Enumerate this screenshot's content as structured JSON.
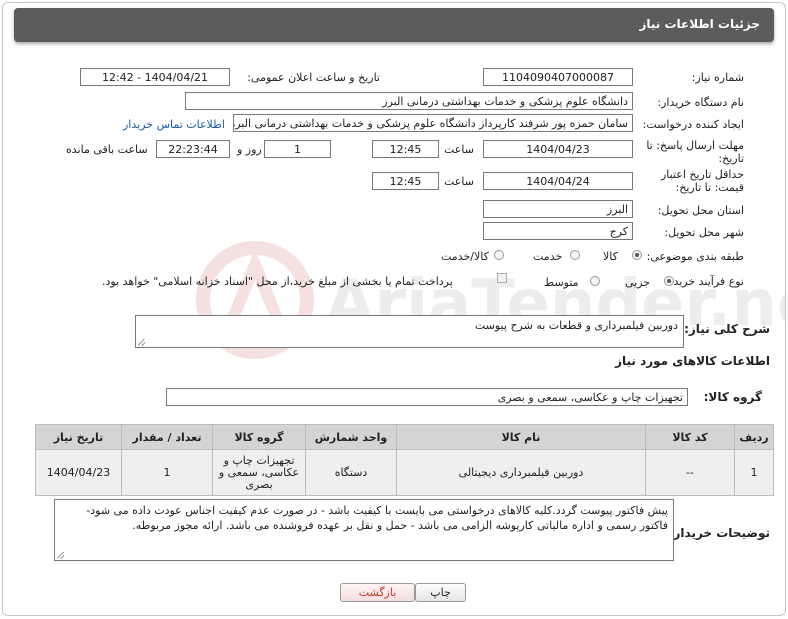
{
  "header": {
    "title": "جزئیات اطلاعات نیاز"
  },
  "fields": {
    "need_number_label": "شماره نیاز:",
    "need_number": "1104090407000087",
    "announce_label": "تاریخ و ساعت اعلان عمومی:",
    "announce_value": "1404/04/21 - 12:42",
    "buyer_label": "نام دستگاه خریدار:",
    "buyer_value": "دانشگاه علوم پزشکی و خدمات بهداشتی  درمانی البرز",
    "creator_label": "ایجاد کننده درخواست:",
    "creator_value": "سامان حمزه پور شرفند کارپرداز دانشگاه علوم پزشکی و خدمات بهداشتی  درمانی البرز",
    "contact_link": "اطلاعات تماس خریدار",
    "deadline_label": "مهلت ارسال پاسخ: تا تاریخ:",
    "deadline_date": "1404/04/23",
    "time_label": "ساعت",
    "deadline_time": "12:45",
    "days_value": "1",
    "days_label": "روز و",
    "remaining_value": "22:23:44",
    "remaining_label": "ساعت باقی مانده",
    "validity_label": "حداقل تاریخ اعتبار قیمت: تا تاریخ:",
    "validity_date": "1404/04/24",
    "validity_time": "12:45",
    "province_label": "استان محل تحویل:",
    "province_value": "البرز",
    "city_label": "شهر محل تحویل:",
    "city_value": "کرج",
    "category_label": "طبقه بندی موضوعی:",
    "category_options": [
      "کالا",
      "خدمت",
      "کالا/خدمت"
    ],
    "process_label": "نوع فرآیند خرید :",
    "process_options": [
      "جزیی",
      "متوسط"
    ],
    "payment_note": "پرداخت تمام یا بخشی از مبلغ خرید،از محل \"اسناد خزانه اسلامی\" خواهد بود."
  },
  "description": {
    "label": "شرح کلی نیاز:",
    "value": "دوربین فیلمبرداری و قطعات به شرح پیوست"
  },
  "goods_info_title": "اطلاعات کالاهای مورد نیاز",
  "goods_group": {
    "label": "گروه کالا:",
    "value": "تجهیزات چاپ و عکاسی، سمعی و بصری"
  },
  "table": {
    "headers": [
      "ردیف",
      "کد کالا",
      "نام کالا",
      "واحد شمارش",
      "گروه کالا",
      "تعداد / مقدار",
      "تاریخ نیاز"
    ],
    "rows": [
      [
        "1",
        "--",
        "دوربین فیلمبرداری دیجیتالی",
        "دستگاه",
        "تجهیزات چاپ و عکاسی، سمعی و بصری",
        "1",
        "1404/04/23"
      ]
    ]
  },
  "buyer_notes": {
    "label": "توضیحات خریدار:",
    "value": "پیش فاکتور پیوست گردد.کلیه کالاهای درخواستی می بایست با کیفیت باشد - در صورت عدم کیفیت اجناس عودت داده می شود- فاکتور رسمی و اداره مالیاتی کارپوشه الزامی می باشد - حمل و نقل بر عهده فروشنده می باشد. ارائه مجوز مربوطه."
  },
  "buttons": {
    "print": "چاپ",
    "back": "بازگشت"
  },
  "watermark_text": "AriaTender.net",
  "colors": {
    "header_bg": "#5c5c5c",
    "link": "#1a5aa0",
    "table_header": "#d4d4d4",
    "back_text": "#c0392b"
  }
}
